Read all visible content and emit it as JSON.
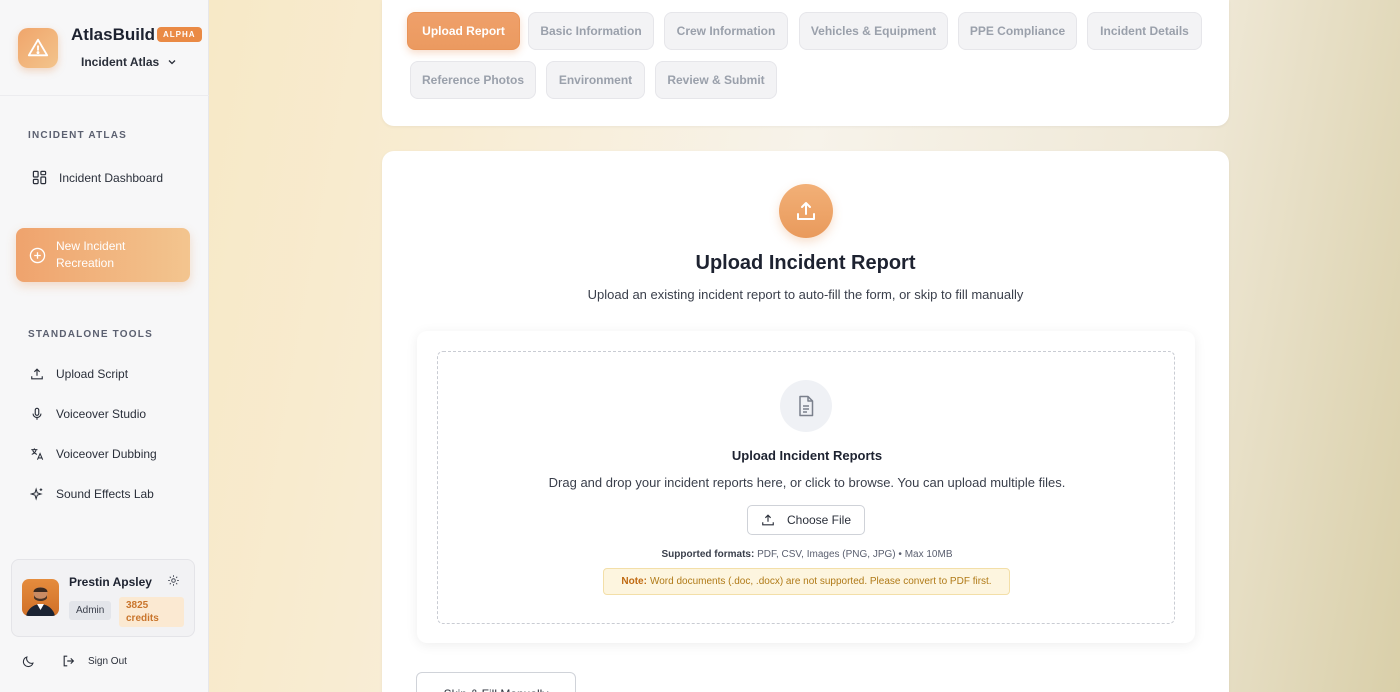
{
  "brand": {
    "name": "AtlasBuild",
    "tag": "ALPHA",
    "workspace": "Incident Atlas"
  },
  "sidebar": {
    "section1": "INCIDENT ATLAS",
    "dashboard": "Incident Dashboard",
    "cta": "New Incident Recreation",
    "section2": "STANDALONE TOOLS",
    "tools": [
      "Upload Script",
      "Voiceover Studio",
      "Voiceover Dubbing",
      "Sound Effects Lab"
    ]
  },
  "user": {
    "name": "Prestin Apsley",
    "role": "Admin",
    "credits": "3825 credits"
  },
  "footer": {
    "signout": "Sign Out"
  },
  "tabs": [
    "Upload Report",
    "Basic Information",
    "Crew Information",
    "Vehicles & Equipment",
    "PPE Compliance",
    "Incident Details",
    "Reference Photos",
    "Environment",
    "Review & Submit"
  ],
  "main": {
    "title": "Upload Incident Report",
    "subtitle": "Upload an existing incident report to auto-fill the form, or skip to fill manually",
    "dropzone_title": "Upload Incident Reports",
    "dropzone_desc": "Drag and drop your incident reports here, or click to browse. You can upload multiple files.",
    "choose_file": "Choose File",
    "formats_label": "Supported formats:",
    "formats_value": "PDF, CSV, Images (PNG, JPG) • Max 10MB",
    "note_label": "Note:",
    "note_value": "Word documents (.doc, .docx) are not supported. Please convert to PDF first.",
    "skip": "Skip & Fill Manually"
  },
  "colors": {
    "accent": "#eb9a60",
    "brand_tag": "#ea8a45"
  }
}
